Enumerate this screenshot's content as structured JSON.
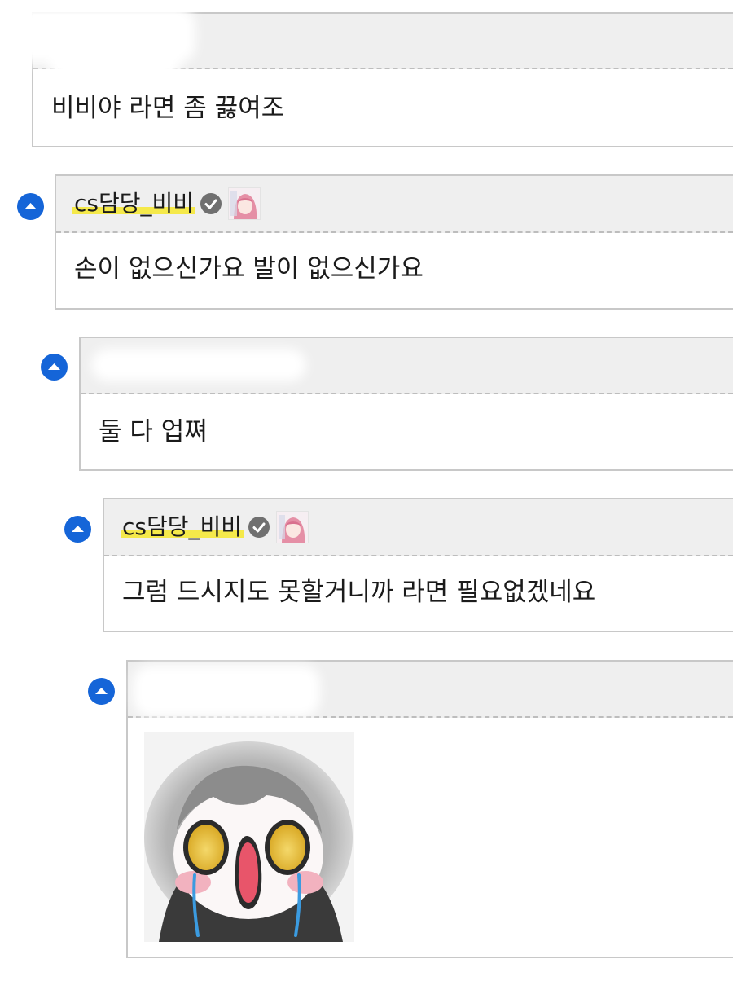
{
  "comments": [
    {
      "text": "비비야 라면 좀 끓여조"
    },
    {
      "author": "cs담당_비비",
      "text": "손이 없으신가요 발이 없으신가요"
    },
    {
      "text": "둘 다 업쪄"
    },
    {
      "author": "cs담당_비비",
      "text": "그럼 드시지도 못할거니까 라면 필요없겠네요"
    },
    {
      "sticker": "crying-character-sticker"
    }
  ],
  "icons": {
    "reply_marker": "collapse-up-icon",
    "verified": "verified-check-icon",
    "profile": "profile-thumbnail"
  },
  "colors": {
    "accent_blue": "#1565d8",
    "highlight_yellow": "#f5e94a",
    "header_gray": "#efefef",
    "border_gray": "#c8c8c8"
  }
}
